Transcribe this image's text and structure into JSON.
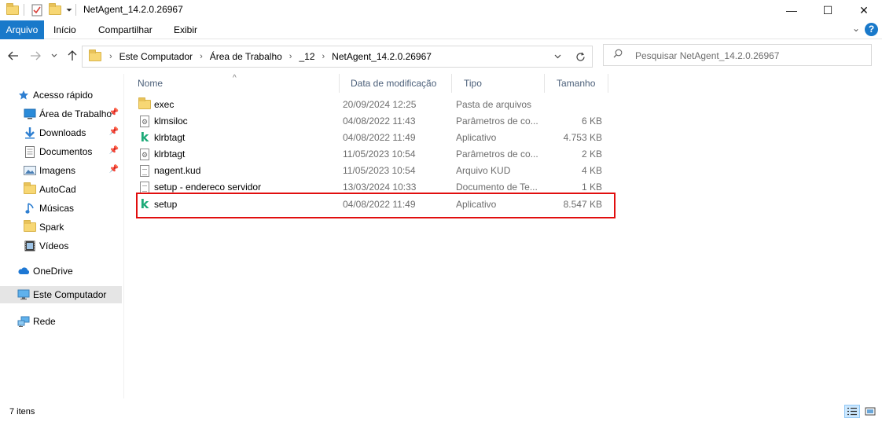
{
  "window": {
    "title": "NetAgent_14.2.0.26967",
    "minimize_glyph": "—",
    "maximize_glyph": "☐",
    "close_glyph": "✕"
  },
  "ribbon": {
    "tabs": [
      "Arquivo",
      "Início",
      "Compartilhar",
      "Exibir"
    ],
    "expand_glyph": "⌄",
    "help_glyph": "?"
  },
  "address": {
    "crumbs": [
      "Este Computador",
      "Área de Trabalho",
      "_12",
      "NetAgent_14.2.0.26967"
    ],
    "search_placeholder": "Pesquisar NetAgent_14.2.0.26967"
  },
  "sidebar": {
    "items": [
      {
        "label": "Acesso rápido",
        "icon": "star-icon",
        "pinned": false
      },
      {
        "label": "Área de Trabalho",
        "icon": "desktop-icon",
        "pinned": true
      },
      {
        "label": "Downloads",
        "icon": "download-icon",
        "pinned": true
      },
      {
        "label": "Documentos",
        "icon": "documents-icon",
        "pinned": true
      },
      {
        "label": "Imagens",
        "icon": "pictures-icon",
        "pinned": true
      },
      {
        "label": "AutoCad",
        "icon": "folder-icon",
        "pinned": false
      },
      {
        "label": "Músicas",
        "icon": "music-icon",
        "pinned": false
      },
      {
        "label": "Spark",
        "icon": "folder-icon",
        "pinned": false
      },
      {
        "label": "Vídeos",
        "icon": "videos-icon",
        "pinned": false
      },
      {
        "label": "OneDrive",
        "icon": "cloud-icon",
        "pinned": false
      },
      {
        "label": "Este Computador",
        "icon": "computer-icon",
        "pinned": false,
        "selected": true
      },
      {
        "label": "Rede",
        "icon": "network-icon",
        "pinned": false
      }
    ]
  },
  "columns": {
    "name": "Nome",
    "date": "Data de modificação",
    "type": "Tipo",
    "size": "Tamanho"
  },
  "files": [
    {
      "name": "exec",
      "date": "20/09/2024 12:25",
      "type": "Pasta de arquivos",
      "size": "",
      "icon": "folder-icon"
    },
    {
      "name": "klmsiloc",
      "date": "04/08/2022 11:43",
      "type": "Parâmetros de co...",
      "size": "6 KB",
      "icon": "settings-file-icon"
    },
    {
      "name": "klrbtagt",
      "date": "04/08/2022 11:49",
      "type": "Aplicativo",
      "size": "4.753 KB",
      "icon": "kaspersky-app-icon"
    },
    {
      "name": "klrbtagt",
      "date": "11/05/2023 10:54",
      "type": "Parâmetros de co...",
      "size": "2 KB",
      "icon": "settings-file-icon"
    },
    {
      "name": "nagent.kud",
      "date": "11/05/2023 10:54",
      "type": "Arquivo KUD",
      "size": "4 KB",
      "icon": "file-icon"
    },
    {
      "name": "setup - endereco servidor",
      "date": "13/03/2024 10:33",
      "type": "Documento de Te...",
      "size": "1 KB",
      "icon": "text-file-icon"
    },
    {
      "name": "setup",
      "date": "04/08/2022 11:49",
      "type": "Aplicativo",
      "size": "8.547 KB",
      "icon": "kaspersky-app-icon"
    }
  ],
  "highlight_color": "#e10e0e",
  "status": {
    "item_count": "7 itens"
  }
}
